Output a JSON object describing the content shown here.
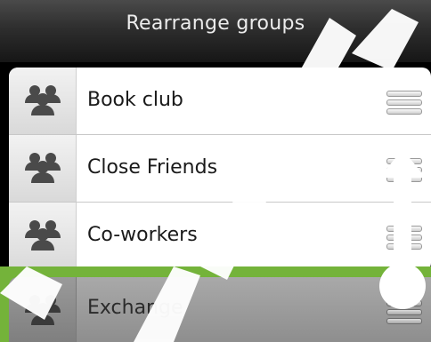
{
  "header": {
    "title": "Rearrange groups"
  },
  "groups": [
    {
      "label": "Book club"
    },
    {
      "label": "Close Friends"
    },
    {
      "label": "Co-workers"
    },
    {
      "label": "Exchange"
    }
  ],
  "icons": {
    "group": "group-people-icon",
    "reorder": "drag-handle-icon"
  },
  "colors": {
    "drop_target": "#74b33a",
    "dragging_row": "#9c9c9c",
    "header": "#2e2e2e"
  }
}
